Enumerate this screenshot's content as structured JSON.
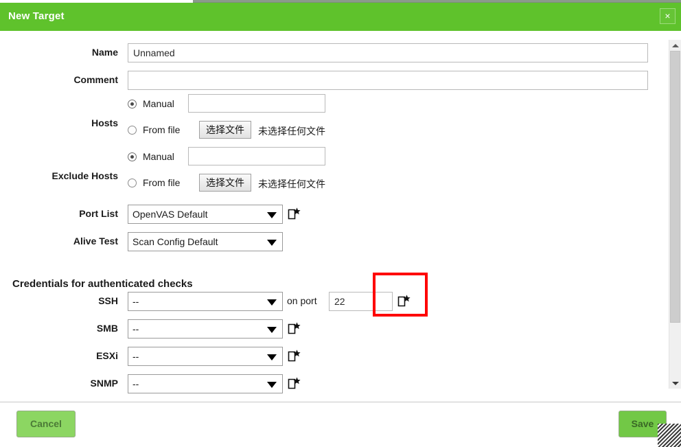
{
  "dialog": {
    "title": "New Target",
    "close_label": "×",
    "accent_color": "#5fc22c"
  },
  "form": {
    "name": {
      "label": "Name",
      "value": "Unnamed",
      "placeholder": ""
    },
    "comment": {
      "label": "Comment",
      "value": "",
      "placeholder": ""
    },
    "hosts": {
      "label": "Hosts",
      "manual_label": "Manual",
      "manual_value": "",
      "manual_selected": true,
      "from_file_label": "From file",
      "from_file_selected": false,
      "file_button_label": "选择文件",
      "file_status": "未选择任何文件"
    },
    "exclude_hosts": {
      "label": "Exclude Hosts",
      "manual_label": "Manual",
      "manual_value": "",
      "manual_selected": true,
      "from_file_label": "From file",
      "from_file_selected": false,
      "file_button_label": "选择文件",
      "file_status": "未选择任何文件"
    },
    "port_list": {
      "label": "Port List",
      "value": "OpenVAS Default"
    },
    "alive_test": {
      "label": "Alive Test",
      "value": "Scan Config Default"
    }
  },
  "credentials": {
    "heading": "Credentials for authenticated checks",
    "on_port_label": "on port",
    "ssh_port_value": "22",
    "rows": [
      {
        "label": "SSH",
        "value": "--"
      },
      {
        "label": "SMB",
        "value": "--"
      },
      {
        "label": "ESXi",
        "value": "--"
      },
      {
        "label": "SNMP",
        "value": "--"
      }
    ]
  },
  "icons": {
    "new_item": "new-item-icon",
    "close": "close-icon",
    "scroll_up": "scroll-up-arrow-icon",
    "scroll_down": "scroll-down-arrow-icon",
    "resize": "resize-grip-icon"
  },
  "footer": {
    "cancel_label": "Cancel",
    "save_label": "Save"
  },
  "annotation": {
    "highlight_color": "#fe0000",
    "target": "new-ssh-credential-icon"
  }
}
